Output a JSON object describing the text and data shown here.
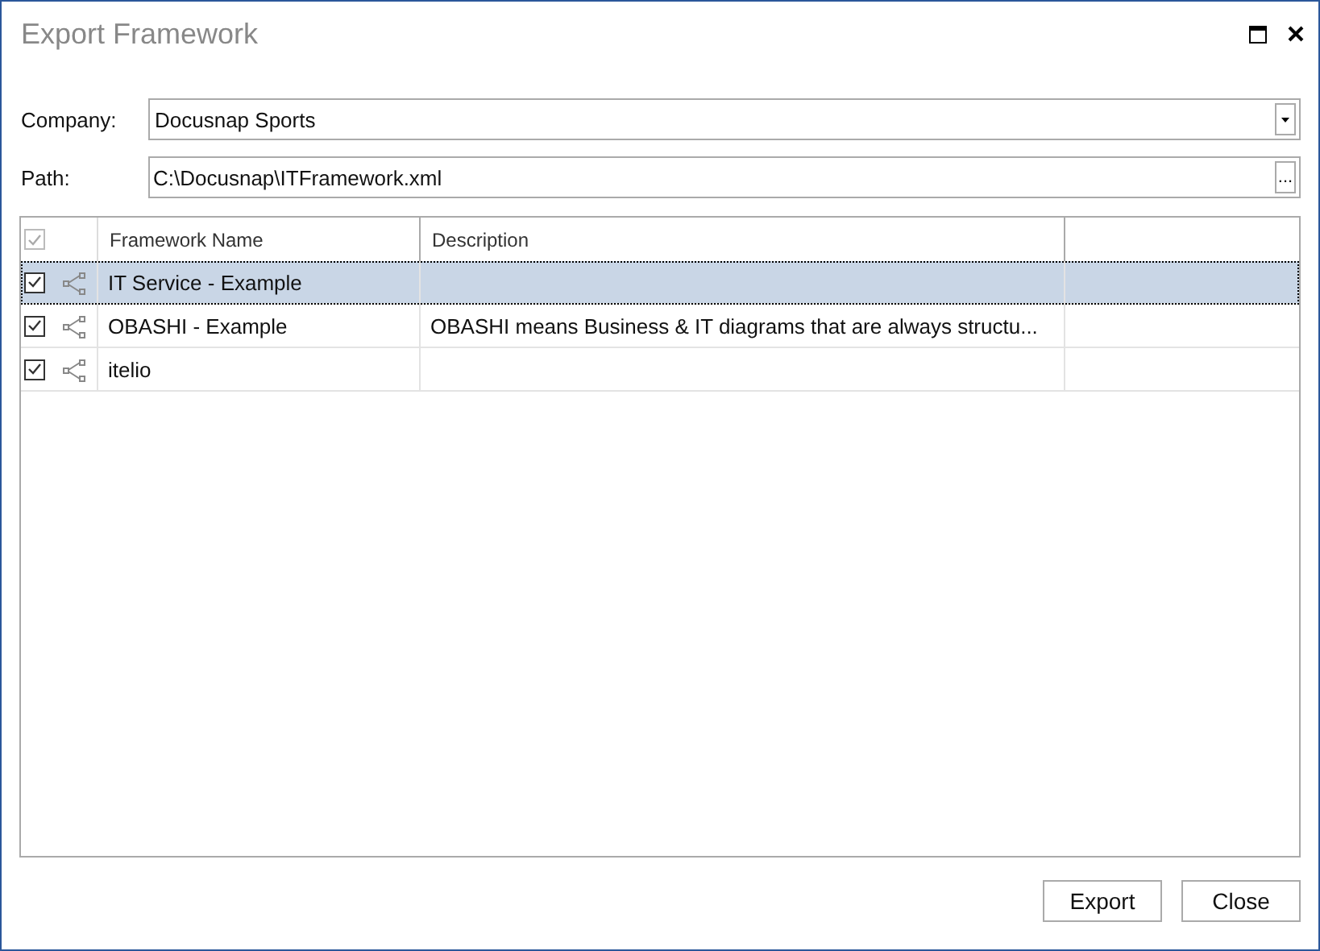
{
  "window": {
    "title": "Export Framework"
  },
  "company": {
    "label": "Company:",
    "value": "Docusnap Sports"
  },
  "path": {
    "label": "Path:",
    "value": "C:\\Docusnap\\ITFramework.xml",
    "browse": "..."
  },
  "table": {
    "header_checked": true,
    "columns": [
      "Framework Name",
      "Description"
    ],
    "rows": [
      {
        "checked": true,
        "selected": true,
        "name": "IT Service - Example",
        "description": ""
      },
      {
        "checked": true,
        "selected": false,
        "name": "OBASHI - Example",
        "description": "OBASHI means Business & IT diagrams that are always structu..."
      },
      {
        "checked": true,
        "selected": false,
        "name": "itelio",
        "description": ""
      }
    ]
  },
  "buttons": [
    "Export",
    "Close"
  ]
}
